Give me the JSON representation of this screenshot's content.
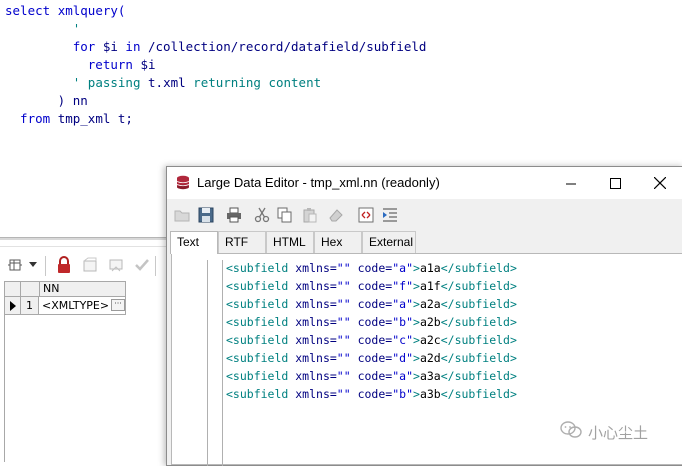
{
  "sql_editor": {
    "lines": [
      {
        "parts": [
          {
            "t": "select ",
            "c": "kw-blue"
          },
          {
            "t": "xmlquery(",
            "c": "kw-blue"
          }
        ]
      },
      {
        "parts": [
          {
            "t": "         '",
            "c": "kw-teal"
          }
        ]
      },
      {
        "parts": [
          {
            "t": "         for ",
            "c": "kw-blue"
          },
          {
            "t": "$i ",
            "c": "plain"
          },
          {
            "t": "in ",
            "c": "kw-blue"
          },
          {
            "t": "/collection/record/datafield/subfield",
            "c": "plain"
          }
        ]
      },
      {
        "parts": [
          {
            "t": "           return ",
            "c": "kw-blue"
          },
          {
            "t": "$i",
            "c": "plain"
          }
        ]
      },
      {
        "parts": [
          {
            "t": "         ' ",
            "c": "kw-teal"
          },
          {
            "t": "passing ",
            "c": "kw-teal"
          },
          {
            "t": "t.xml ",
            "c": "plain"
          },
          {
            "t": "returning ",
            "c": "kw-teal"
          },
          {
            "t": "content",
            "c": "kw-teal"
          }
        ]
      },
      {
        "parts": [
          {
            "t": "       ) ",
            "c": "plain"
          },
          {
            "t": "nn",
            "c": "plain"
          }
        ]
      },
      {
        "parts": [
          {
            "t": "  from ",
            "c": "kw-blue"
          },
          {
            "t": "tmp_xml ",
            "c": "plain"
          },
          {
            "t": "t;",
            "c": "plain"
          }
        ]
      }
    ]
  },
  "result_grid": {
    "column_header": "NN",
    "rows": [
      {
        "num": "1",
        "value": "<XMLTYPE>",
        "button": "···"
      }
    ]
  },
  "dialog": {
    "title": "Large Data Editor - tmp_xml.nn (readonly)",
    "tabs": [
      "Text",
      "RTF",
      "HTML",
      "Hex",
      "External"
    ],
    "active_tab": "Text",
    "xml_lines": [
      {
        "code": "a",
        "text": "a1a"
      },
      {
        "code": "f",
        "text": "a1f"
      },
      {
        "code": "a",
        "text": "a2a"
      },
      {
        "code": "b",
        "text": "a2b"
      },
      {
        "code": "c",
        "text": "a2c"
      },
      {
        "code": "d",
        "text": "a2d"
      },
      {
        "code": "a",
        "text": "a3a"
      },
      {
        "code": "b",
        "text": "a3b"
      }
    ]
  },
  "watermark": {
    "text": "小心尘土"
  }
}
